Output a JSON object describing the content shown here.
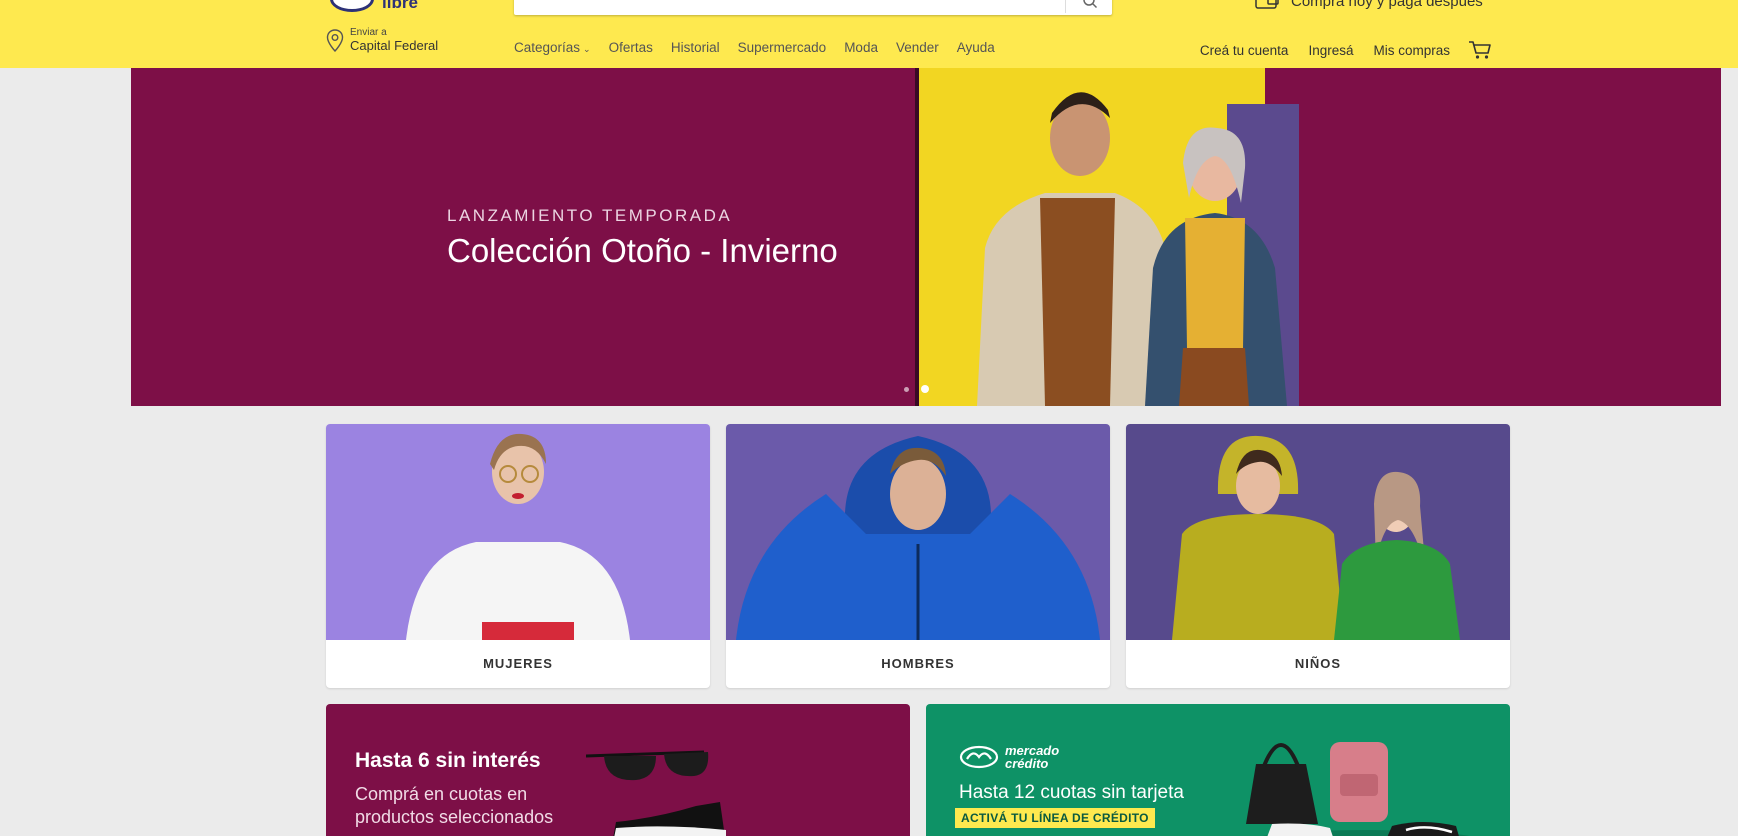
{
  "header": {
    "logo_text": "libre",
    "promo_text": "Comprá hoy y pagá después",
    "location": {
      "small": "Enviar a",
      "city": "Capital Federal"
    },
    "nav": [
      {
        "label": "Categorías",
        "caret": "⌄"
      },
      {
        "label": "Ofertas"
      },
      {
        "label": "Historial"
      },
      {
        "label": "Supermercado"
      },
      {
        "label": "Moda"
      },
      {
        "label": "Vender"
      },
      {
        "label": "Ayuda"
      }
    ],
    "user_nav": {
      "create_account": "Creá tu cuenta",
      "login": "Ingresá",
      "purchases": "Mis compras"
    }
  },
  "hero": {
    "kicker": "LANZAMIENTO TEMPORADA",
    "title": "Colección Otoño - Invierno",
    "slides": 2,
    "active_slide": 2
  },
  "categories": [
    {
      "label": "MUJERES"
    },
    {
      "label": "HOMBRES"
    },
    {
      "label": "NIÑOS"
    }
  ],
  "promos": {
    "left": {
      "title": "Hasta 6 sin interés",
      "subtitle": "Comprá en cuotas en productos seleccionados"
    },
    "right": {
      "logo_line1": "mercado",
      "logo_line2": "crédito",
      "title": "Hasta 12 cuotas sin tarjeta",
      "cta": "ACTIVÁ TU LÍNEA DE CRÉDITO"
    }
  },
  "colors": {
    "header_yellow": "#fee94f",
    "brand_navy": "#2d3277",
    "hero_magenta": "#7d0f47",
    "credit_green": "#0e9266"
  }
}
